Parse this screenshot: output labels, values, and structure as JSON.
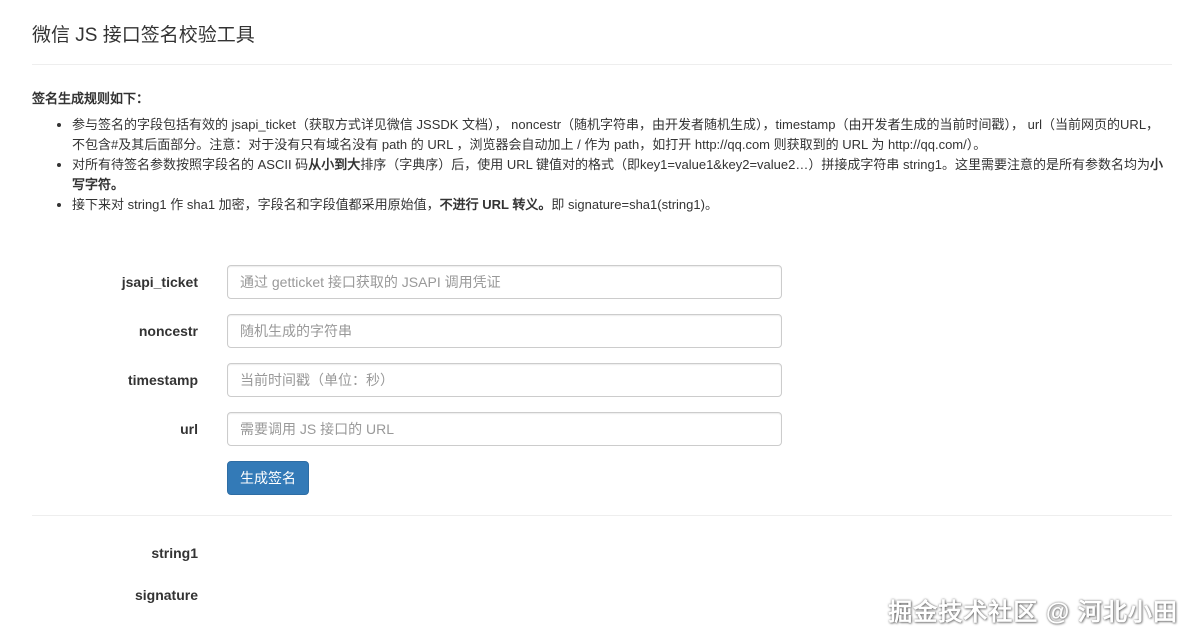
{
  "page": {
    "title": "微信 JS 接口签名校验工具"
  },
  "rules": {
    "heading": "签名生成规则如下：",
    "items": [
      {
        "parts": [
          {
            "text": "参与签名的字段包括有效的 jsapi_ticket（获取方式详见微信 JSSDK 文档）， noncestr（随机字符串，由开发者随机生成），timestamp（由开发者生成的当前时间戳）， url（当前网页的URL，不包含#及其后面部分。注意：对于没有只有域名没有 path 的 URL ，浏览器会自动加上 / 作为 path，如打开 http://qq.com 则获取到的 URL 为 http://qq.com/）。",
            "bold": false
          }
        ]
      },
      {
        "parts": [
          {
            "text": "对所有待签名参数按照字段名的 ASCII 码",
            "bold": false
          },
          {
            "text": "从小到大",
            "bold": true
          },
          {
            "text": "排序（字典序）后，使用 URL 键值对的格式（即key1=value1&key2=value2…）拼接成字符串 string1。这里需要注意的是所有参数名均为",
            "bold": false
          },
          {
            "text": "小写字符。",
            "bold": true
          }
        ]
      },
      {
        "parts": [
          {
            "text": "接下来对 string1 作 sha1 加密，字段名和字段值都采用原始值，",
            "bold": false
          },
          {
            "text": "不进行 URL 转义。",
            "bold": true
          },
          {
            "text": "即 signature=sha1(string1)。",
            "bold": false
          }
        ]
      }
    ]
  },
  "form": {
    "jsapi_ticket": {
      "label": "jsapi_ticket",
      "value": "",
      "placeholder": "通过 getticket 接口获取的 JSAPI 调用凭证"
    },
    "noncestr": {
      "label": "noncestr",
      "value": "",
      "placeholder": "随机生成的字符串"
    },
    "timestamp": {
      "label": "timestamp",
      "value": "",
      "placeholder": "当前时间戳（单位：秒）"
    },
    "url": {
      "label": "url",
      "value": "",
      "placeholder": "需要调用 JS 接口的 URL"
    },
    "submit_label": "生成签名"
  },
  "results": {
    "string1_label": "string1",
    "string1_value": "",
    "signature_label": "signature",
    "signature_value": ""
  },
  "watermark": "掘金技术社区 @ 河北小田",
  "colors": {
    "primary": "#337ab7",
    "border": "#cccccc",
    "divider": "#eeeeee",
    "text": "#333333",
    "placeholder": "#999999"
  }
}
